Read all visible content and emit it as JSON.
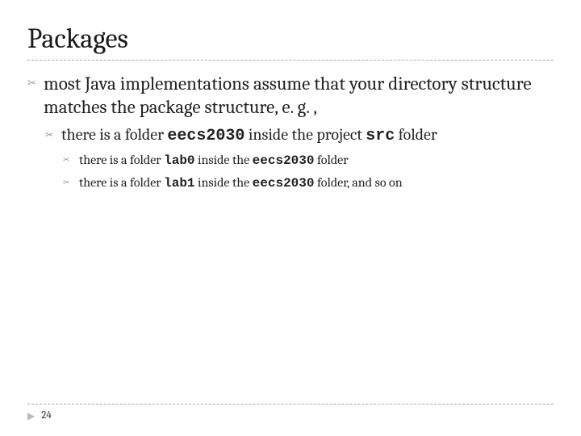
{
  "title": "Packages",
  "bullets": {
    "l1": "most Java implementations assume that your directory structure matches the package structure, e. g. ,",
    "l2_pre": "there is a folder ",
    "l2_code1": "eecs2030",
    "l2_mid": " inside the project ",
    "l2_code2": "src",
    "l2_post": " folder",
    "l3a_pre": "there is a folder ",
    "l3a_code1": "lab0",
    "l3a_mid": " inside the ",
    "l3a_code2": "eecs2030",
    "l3a_post": " folder",
    "l3b_pre": "there is a folder ",
    "l3b_code1": "lab1",
    "l3b_mid": " inside the ",
    "l3b_code2": "eecs2030",
    "l3b_post": " folder, and so on"
  },
  "page_number": "24"
}
